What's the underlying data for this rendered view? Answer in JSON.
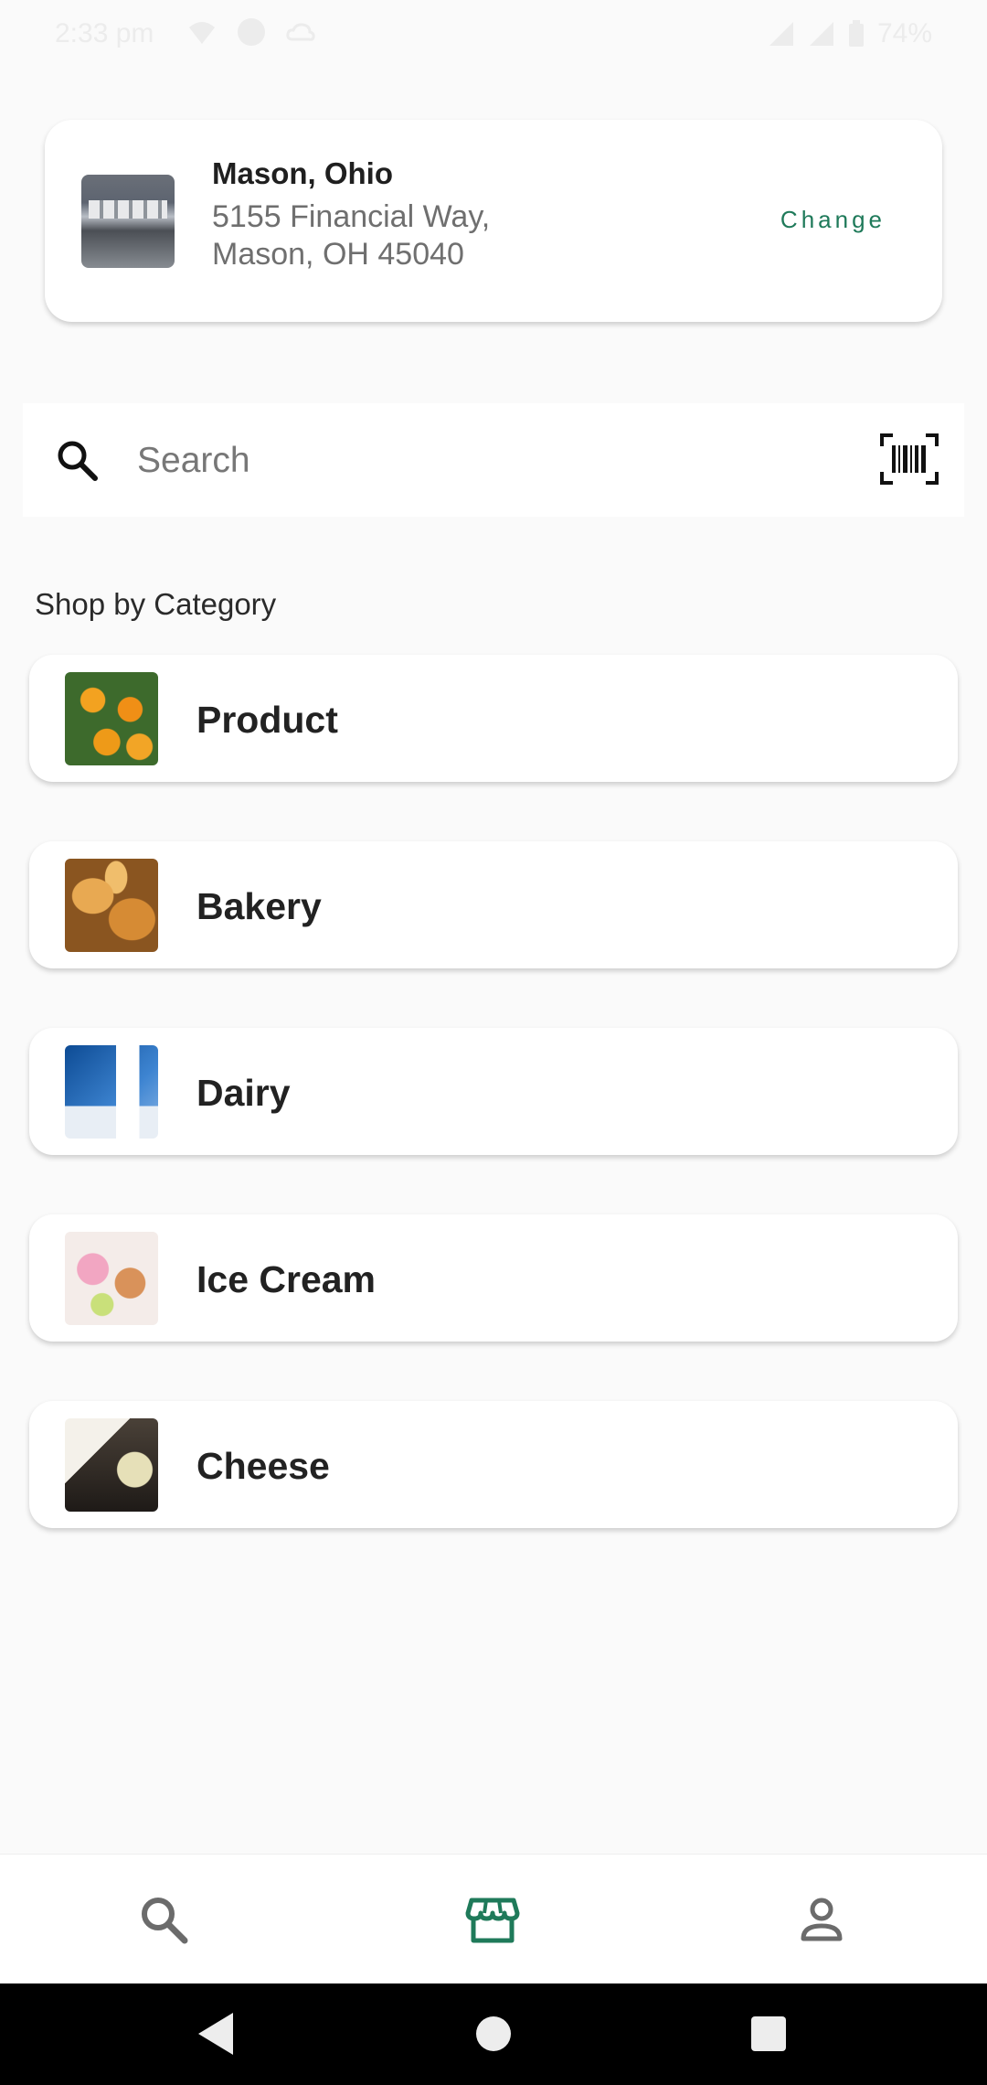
{
  "status_bar": {
    "time": "2:33 pm",
    "battery": "74%"
  },
  "store": {
    "city": "Mason, Ohio",
    "address_line1": "5155 Financial Way,",
    "address_line2": "Mason, OH 45040",
    "change_label": "Change"
  },
  "search": {
    "placeholder": "Search"
  },
  "categories": {
    "title": "Shop by Category",
    "items": [
      {
        "label": "Product"
      },
      {
        "label": "Bakery"
      },
      {
        "label": "Dairy"
      },
      {
        "label": "Ice Cream"
      },
      {
        "label": "Cheese"
      }
    ]
  },
  "colors": {
    "accent": "#1f7a5a",
    "background": "#fafafa",
    "card": "#ffffff"
  },
  "bottom_nav": {
    "items": [
      {
        "icon": "search-icon"
      },
      {
        "icon": "store-icon",
        "active": true
      },
      {
        "icon": "profile-icon"
      }
    ]
  }
}
